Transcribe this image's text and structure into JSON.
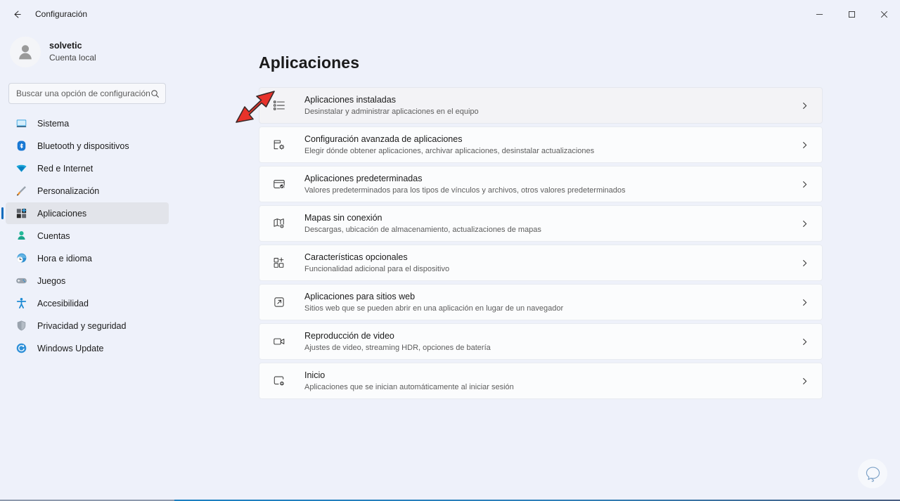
{
  "window": {
    "title": "Configuración",
    "back_icon": "back-arrow-icon",
    "controls": {
      "minimize": "minimize-icon",
      "maximize": "maximize-icon",
      "close": "close-icon"
    }
  },
  "colors": {
    "background": "#eef1fa",
    "card": "#fbfcfd",
    "card_hover": "#f3f3f6",
    "accent": "#0f6cbd",
    "annotation_arrow": "#e8322a",
    "text_primary": "#1b1b1b",
    "text_secondary": "#5d5d5d"
  },
  "sidebar": {
    "profile": {
      "name": "solvetic",
      "account_type": "Cuenta local",
      "avatar_icon": "person-avatar-icon"
    },
    "search": {
      "placeholder": "Buscar una opción de configuración",
      "value": "",
      "icon": "search-icon"
    },
    "items": [
      {
        "label": "Sistema",
        "icon": "monitor-icon",
        "selected": false
      },
      {
        "label": "Bluetooth y dispositivos",
        "icon": "bluetooth-icon",
        "selected": false
      },
      {
        "label": "Red e Internet",
        "icon": "wifi-icon",
        "selected": false
      },
      {
        "label": "Personalización",
        "icon": "paintbrush-icon",
        "selected": false
      },
      {
        "label": "Aplicaciones",
        "icon": "apps-icon",
        "selected": true
      },
      {
        "label": "Cuentas",
        "icon": "account-icon",
        "selected": false
      },
      {
        "label": "Hora e idioma",
        "icon": "clock-globe-icon",
        "selected": false
      },
      {
        "label": "Juegos",
        "icon": "gamepad-icon",
        "selected": false
      },
      {
        "label": "Accesibilidad",
        "icon": "accessibility-icon",
        "selected": false
      },
      {
        "label": "Privacidad y seguridad",
        "icon": "shield-icon",
        "selected": false
      },
      {
        "label": "Windows Update",
        "icon": "update-icon",
        "selected": false
      }
    ]
  },
  "main": {
    "page_title": "Aplicaciones",
    "cards": [
      {
        "title": "Aplicaciones instaladas",
        "subtitle": "Desinstalar y administrar aplicaciones en el equipo",
        "icon": "installed-apps-list-icon",
        "hovered": true
      },
      {
        "title": "Configuración avanzada de aplicaciones",
        "subtitle": "Elegir dónde obtener aplicaciones, archivar aplicaciones, desinstalar actualizaciones",
        "icon": "app-settings-gear-icon",
        "hovered": false
      },
      {
        "title": "Aplicaciones predeterminadas",
        "subtitle": "Valores predeterminados para los tipos de vínculos y archivos, otros valores predeterminados",
        "icon": "default-apps-check-icon",
        "hovered": false
      },
      {
        "title": "Mapas sin conexión",
        "subtitle": "Descargas, ubicación de almacenamiento, actualizaciones de mapas",
        "icon": "offline-maps-icon",
        "hovered": false
      },
      {
        "title": "Características opcionales",
        "subtitle": "Funcionalidad adicional para el dispositivo",
        "icon": "optional-features-grid-plus-icon",
        "hovered": false
      },
      {
        "title": "Aplicaciones para sitios web",
        "subtitle": "Sitios web que se pueden abrir en una aplicación en lugar de un navegador",
        "icon": "web-apps-external-link-icon",
        "hovered": false
      },
      {
        "title": "Reproducción de video",
        "subtitle": "Ajustes de video, streaming HDR, opciones de batería",
        "icon": "video-playback-camera-icon",
        "hovered": false
      },
      {
        "title": "Inicio",
        "subtitle": "Aplicaciones que se inician automáticamente al iniciar sesión",
        "icon": "startup-power-icon",
        "hovered": false
      }
    ],
    "chevron_icon": "chevron-right-icon"
  },
  "annotation": {
    "arrow_icon": "red-pointer-arrow-icon",
    "points_at": "Aplicaciones instaladas"
  },
  "feedback": {
    "icon": "feedback-chat-bubble-icon"
  }
}
